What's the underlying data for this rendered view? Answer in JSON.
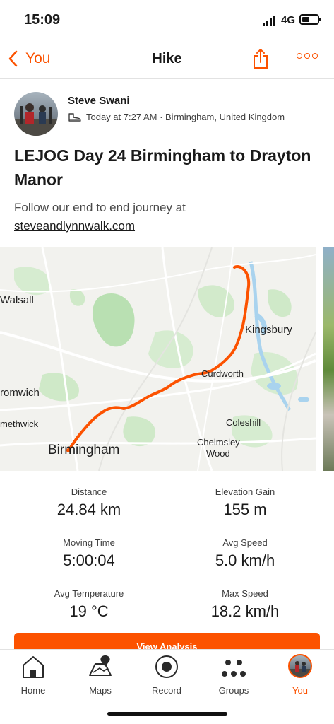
{
  "status_bar": {
    "time": "15:09",
    "network": "4G"
  },
  "nav": {
    "back_label": "You",
    "title": "Hike"
  },
  "athlete": {
    "name": "Steve Swani",
    "meta": "Today at 7:27 AM · Birmingham, United Kingdom"
  },
  "activity": {
    "title": "LEJOG Day 24 Birmingham to Drayton Manor",
    "description": "Follow our end to end journey at",
    "link": "steveandlynnwalk.com"
  },
  "map": {
    "labels": {
      "walsall": "Walsall",
      "kingsbury": "Kingsbury",
      "curdworth": "Curdworth",
      "bromwich": "romwich",
      "smethwick": "methwick",
      "coleshill": "Coleshill",
      "chelmsley": "Chelmsley",
      "wood": "Wood",
      "birmingham": "Birmingham"
    },
    "route_color": "#fc5200"
  },
  "stats": [
    {
      "label": "Distance",
      "value": "24.84 km"
    },
    {
      "label": "Elevation Gain",
      "value": "155 m"
    },
    {
      "label": "Moving Time",
      "value": "5:00:04"
    },
    {
      "label": "Avg Speed",
      "value": "5.0 km/h"
    },
    {
      "label": "Avg Temperature",
      "value": "19 °C"
    },
    {
      "label": "Max Speed",
      "value": "18.2 km/h"
    }
  ],
  "analysis_button": "View Analysis",
  "tabs": [
    {
      "label": "Home",
      "icon": "home-icon"
    },
    {
      "label": "Maps",
      "icon": "map-icon"
    },
    {
      "label": "Record",
      "icon": "record-icon"
    },
    {
      "label": "Groups",
      "icon": "groups-icon"
    },
    {
      "label": "You",
      "icon": "avatar"
    }
  ],
  "colors": {
    "accent": "#fc5200",
    "text": "#1a1a1a",
    "secondary": "#3d3d3d"
  }
}
